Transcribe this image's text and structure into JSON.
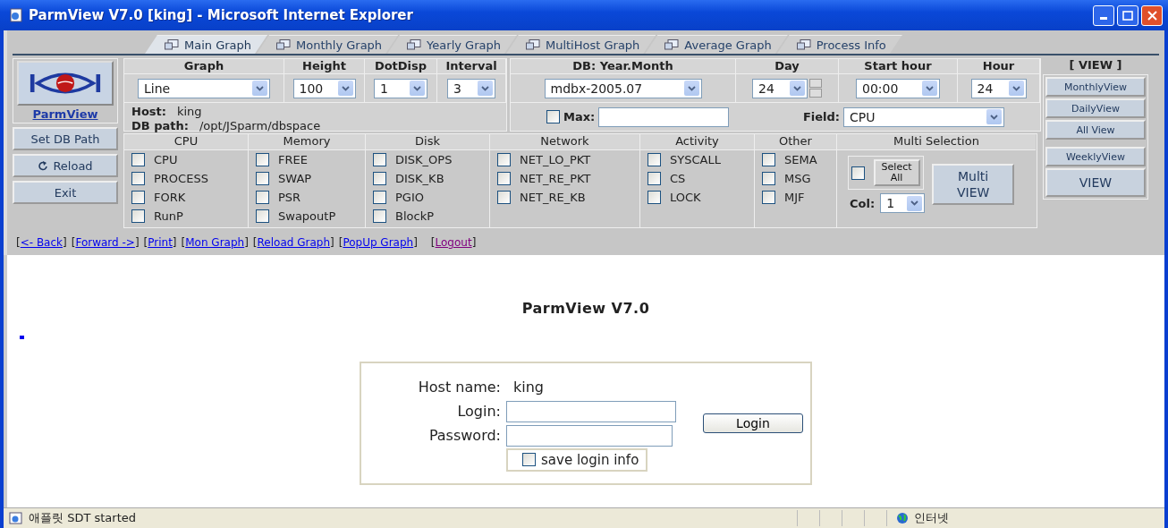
{
  "window": {
    "title": "ParmView V7.0 [king] - Microsoft Internet Explorer"
  },
  "tabs": [
    {
      "label": "Main Graph",
      "selected": true
    },
    {
      "label": "Monthly Graph",
      "selected": false
    },
    {
      "label": "Yearly Graph",
      "selected": false
    },
    {
      "label": "MultiHost Graph",
      "selected": false
    },
    {
      "label": "Average Graph",
      "selected": false
    },
    {
      "label": "Process Info",
      "selected": false
    }
  ],
  "logo": {
    "label": "ParmView"
  },
  "side_buttons": [
    {
      "label": "Set DB Path",
      "kind": "plain"
    },
    {
      "label": "Reload",
      "kind": "reload"
    },
    {
      "label": "Exit",
      "kind": "plain"
    }
  ],
  "graph_params": [
    {
      "label": "Graph",
      "value": "Line"
    },
    {
      "label": "Height",
      "value": "100"
    },
    {
      "label": "DotDisp",
      "value": "1"
    },
    {
      "label": "Interval",
      "value": "3"
    }
  ],
  "host": {
    "label": "Host:",
    "value": "king"
  },
  "db_path": {
    "label": "DB path:",
    "value": "/opt/JSparm/dbspace"
  },
  "db_params": [
    {
      "label": "DB: Year.Month",
      "value": "mdbx-2005.07",
      "kind": "select"
    },
    {
      "label": "Day",
      "value": "24",
      "kind": "spinner"
    },
    {
      "label": "Start hour",
      "value": "00:00",
      "kind": "select"
    },
    {
      "label": "Hour",
      "value": "24",
      "kind": "select"
    }
  ],
  "max": {
    "label": "Max:",
    "checked": false
  },
  "field": {
    "label": "Field:",
    "value": "CPU"
  },
  "categories": [
    {
      "title": "CPU",
      "items": [
        {
          "label": "CPU",
          "checked": false
        },
        {
          "label": "PROCESS",
          "checked": false
        },
        {
          "label": "FORK",
          "checked": false
        },
        {
          "label": "RunP",
          "checked": false
        }
      ]
    },
    {
      "title": "Memory",
      "items": [
        {
          "label": "FREE",
          "checked": false
        },
        {
          "label": "SWAP",
          "checked": false
        },
        {
          "label": "PSR",
          "checked": false
        },
        {
          "label": "SwapoutP",
          "checked": false
        }
      ]
    },
    {
      "title": "Disk",
      "items": [
        {
          "label": "DISK_OPS",
          "checked": false
        },
        {
          "label": "DISK_KB",
          "checked": false
        },
        {
          "label": "PGIO",
          "checked": false
        },
        {
          "label": "BlockP",
          "checked": false
        }
      ]
    },
    {
      "title": "Network",
      "items": [
        {
          "label": "NET_LO_PKT",
          "checked": false
        },
        {
          "label": "NET_RE_PKT",
          "checked": false
        },
        {
          "label": "NET_RE_KB",
          "checked": false
        }
      ]
    },
    {
      "title": "Activity",
      "items": [
        {
          "label": "SYSCALL",
          "checked": false
        },
        {
          "label": "CS",
          "checked": false
        },
        {
          "label": "LOCK",
          "checked": false
        }
      ]
    },
    {
      "title": "Other",
      "items": [
        {
          "label": "SEMA",
          "checked": false
        },
        {
          "label": "MSG",
          "checked": false
        },
        {
          "label": "MJF",
          "checked": false
        }
      ]
    }
  ],
  "multi_selection": {
    "title": "Multi Selection",
    "checked": false,
    "select_all": "Select All",
    "col_label": "Col:",
    "col_value": "1",
    "button": "Multi VIEW"
  },
  "view": {
    "title": "[ VIEW ]",
    "buttons": [
      {
        "label": "MonthlyView",
        "kind": "small"
      },
      {
        "label": "DailyView",
        "kind": "small"
      },
      {
        "label": "All View",
        "kind": "small"
      },
      {
        "label": "WeeklyView",
        "kind": "small"
      },
      {
        "label": "VIEW",
        "kind": "large"
      }
    ]
  },
  "links": [
    {
      "before": "[",
      "label": "<- Back",
      "after": "]",
      "visited": false
    },
    {
      "before": "[",
      "label": "Forward ->",
      "after": "]",
      "visited": false
    },
    {
      "before": "[",
      "label": "Print",
      "after": "]",
      "visited": false
    },
    {
      "before": "[",
      "label": "Mon Graph",
      "after": "]",
      "visited": false
    },
    {
      "before": "[",
      "label": "Reload Graph",
      "after": "]",
      "visited": false
    },
    {
      "before": "[",
      "label": "PopUp Graph",
      "after": "]",
      "visited": false
    },
    {
      "before": "[",
      "label": "Logout",
      "after": "]",
      "visited": true
    }
  ],
  "heading": "ParmView V7.0",
  "login": {
    "host_label": "Host name:",
    "host_value": "king",
    "login_label": "Login:",
    "password_label": "Password:",
    "button": "Login",
    "save": {
      "label": "save login info",
      "checked": false
    }
  },
  "status_bar": {
    "text": "애플릿 SDT started",
    "zone": "인터넷"
  }
}
